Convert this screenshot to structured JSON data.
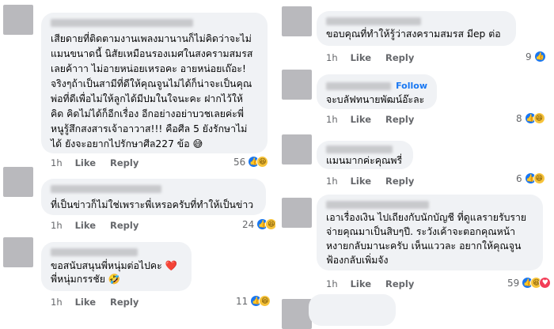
{
  "actions": {
    "time": "1h",
    "like": "Like",
    "reply": "Reply"
  },
  "left": [
    {
      "text": "เสียดายที่ติดตามงานเพลงมานานก็ไม่คิดว่าจะไม่\nแมนขนาดนี้ นิสัยเหมือนรองเมศในสงครามสมรส\nเลยค้าาา ไม่อายหน่อยเหรอคะ อายหน่อยเถ๊อะ!\nจริงๆถ้าเป็นสามีที่ดีให้คุณจูนไม่ได้ก็น่าจะเป็นคุณ\nพ่อที่ดีเพื่อไม่ให้ลูกได้มีปมในใจนะคะ ฝากไว้ให้\nคิด คิดไม่ได้ก็อีกเรื่อง อีกอย่างอย่าบวชเลยค่ะพี่\nหนูรู้สึกสงสารเจ้าอาวาส!!! คือศีล 5 ยังรักษาไม่\nได้ ยังจะอยากไปรักษาศีล227 ข้อ 😅",
      "count": "56",
      "reactions": [
        "like",
        "haha"
      ]
    },
    {
      "text": "ที่เป็นข่าวก็ไม่ใช่เพราะพี่เหรอครับที่ทำให้เป็นข่าว",
      "count": "24",
      "reactions": [
        "like",
        "haha"
      ]
    },
    {
      "text": "ขอสนับสนุนพี่หนุ่มต่อไปคะ ❤️\nพี่หนุ่มกรรชัย 🤣",
      "count": "11",
      "reactions": [
        "like",
        "haha"
      ]
    }
  ],
  "right": [
    {
      "text": "ขอบคุณที่ทำให้รู้ว่าสงครามสมรส มีep ต่อ",
      "count": "9",
      "reactions": [
        "like"
      ]
    },
    {
      "follow": "Follow",
      "text": "จะบลัฟทนายพัฒน์อ๊ะละ",
      "count": "8",
      "reactions": [
        "like",
        "haha"
      ]
    },
    {
      "text": "แมนมากค่ะคุณพรี่",
      "count": "6",
      "reactions": [
        "like",
        "haha"
      ]
    },
    {
      "text": "เอาเรื่องเงิน ไปเถียงกับนักบัญชี ที่ดูแลรายรับราย\nจ่ายคุณมาเป็นสิบๆปี.  ระวังเค้าจะตอกคุณหน้า\nหงายกลับมานะครับ เห็นแววละ  อยากให้คุณจูน\nฟ้องกลับเพิ่มจัง",
      "count": "59",
      "reactions": [
        "like",
        "haha",
        "love"
      ]
    }
  ]
}
